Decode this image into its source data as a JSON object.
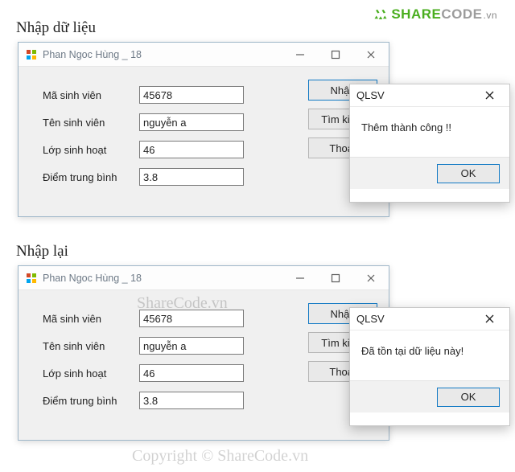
{
  "logo": {
    "text_colored": "SHARE",
    "text_gray": "CODE",
    "suffix": ".vn"
  },
  "watermarks": {
    "center": "ShareCode.vn",
    "copyright": "Copyright © ShareCode.vn"
  },
  "section1": {
    "caption": "Nhập dữ liệu",
    "window": {
      "title": "Phan Ngoc Hùng _ 18",
      "labels": {
        "id": "Mã sinh viên",
        "name": "Tên sinh viên",
        "class": "Lớp sinh hoạt",
        "gpa": "Điểm trung bình"
      },
      "values": {
        "id": "45678",
        "name": "nguyễn a",
        "class": "46",
        "gpa": "3.8"
      },
      "buttons": {
        "insert": "Nhập",
        "search": "Tìm kiếm",
        "exit": "Thoát"
      }
    },
    "dialog": {
      "title": "QLSV",
      "message": "Thêm thành công !!",
      "ok": "OK"
    }
  },
  "section2": {
    "caption": "Nhập lại",
    "window": {
      "title": "Phan Ngoc Hùng _ 18",
      "labels": {
        "id": "Mã sinh viên",
        "name": "Tên sinh viên",
        "class": "Lớp sinh hoạt",
        "gpa": "Điểm trung bình"
      },
      "values": {
        "id": "45678",
        "name": "nguyễn a",
        "class": "46",
        "gpa": "3.8"
      },
      "buttons": {
        "insert": "Nhập",
        "search": "Tìm kiếm",
        "exit": "Thoát"
      }
    },
    "dialog": {
      "title": "QLSV",
      "message": "Đã tồn tại dữ liệu này!",
      "ok": "OK"
    }
  }
}
